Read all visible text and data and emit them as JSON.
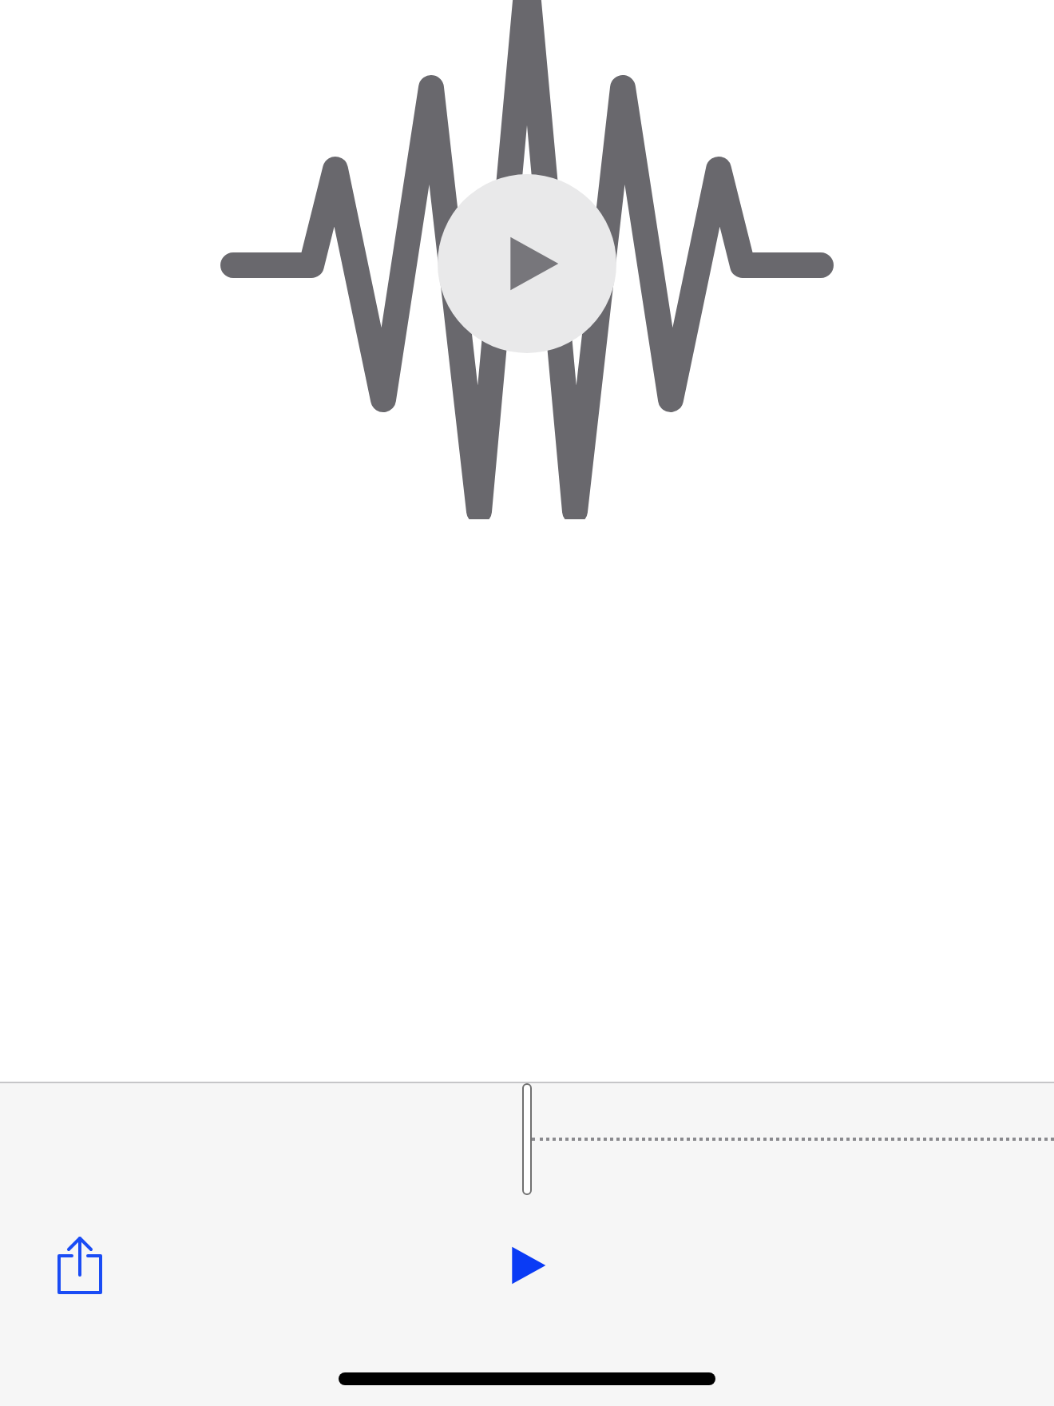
{
  "playback": {
    "playing": false
  }
}
